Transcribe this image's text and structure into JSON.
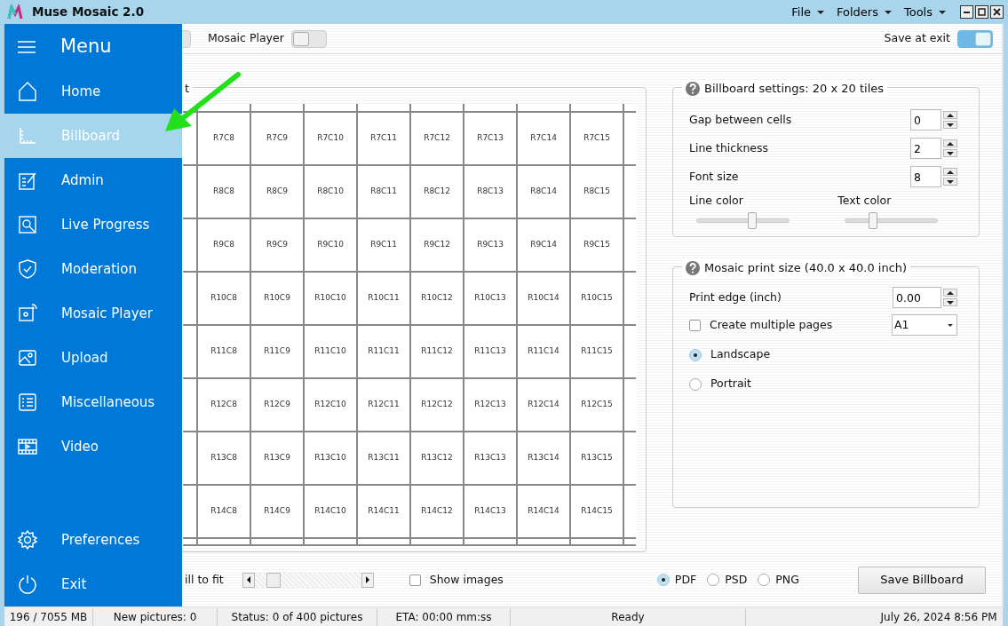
{
  "window": {
    "title": "Muse Mosaic 2.0",
    "menus": [
      "File",
      "Folders",
      "Tools"
    ]
  },
  "toolbar": {
    "toggles": [
      {
        "on": false
      },
      {
        "label": "Mosaic Player",
        "on": false
      },
      {
        "label": "Save at exit",
        "on": true
      }
    ]
  },
  "layout_group": {
    "title": "t",
    "rows": [
      [
        "R7C8",
        "R7C9",
        "R7C10",
        "R7C11",
        "R7C12",
        "R7C13",
        "R7C14",
        "R7C15"
      ],
      [
        "R8C8",
        "R8C9",
        "R8C10",
        "R8C11",
        "R8C12",
        "R8C13",
        "R8C14",
        "R8C15"
      ],
      [
        "R9C8",
        "R9C9",
        "R9C10",
        "R9C11",
        "R9C12",
        "R9C13",
        "R9C14",
        "R9C15"
      ],
      [
        "R10C8",
        "R10C9",
        "R10C10",
        "R10C11",
        "R10C12",
        "R10C13",
        "R10C14",
        "R10C15"
      ],
      [
        "R11C8",
        "R11C9",
        "R11C10",
        "R11C11",
        "R11C12",
        "R11C13",
        "R11C14",
        "R11C15"
      ],
      [
        "R12C8",
        "R12C9",
        "R12C10",
        "R12C11",
        "R12C12",
        "R12C13",
        "R12C14",
        "R12C15"
      ],
      [
        "R13C8",
        "R13C9",
        "R13C10",
        "R13C11",
        "R13C12",
        "R13C13",
        "R13C14",
        "R13C15"
      ],
      [
        "R14C8",
        "R14C9",
        "R14C10",
        "R14C11",
        "R14C12",
        "R14C13",
        "R14C14",
        "R14C15"
      ]
    ]
  },
  "billboard_settings": {
    "title": "Billboard settings: 20 x 20 tiles",
    "spinners": [
      {
        "label": "Gap between cells",
        "value": "0"
      },
      {
        "label": "Line thickness",
        "value": "2"
      },
      {
        "label": "Font size",
        "value": "8"
      }
    ],
    "sliders": [
      {
        "label": "Line color",
        "level": 0.6
      },
      {
        "label": "Text color",
        "level": 0.3
      }
    ]
  },
  "print_size": {
    "title": "Mosaic print size (40.0 x 40.0 inch)",
    "print_edge": {
      "label": "Print edge (inch)",
      "value": "0.00"
    },
    "multiple_pages": {
      "label": "Create multiple pages",
      "checked": false
    },
    "paper": {
      "value": "A1"
    },
    "orientation": [
      {
        "label": "Landscape",
        "selected": true
      },
      {
        "label": "Portrait",
        "selected": false
      }
    ]
  },
  "bottom": {
    "fill_label": "ill to fit",
    "show_images": {
      "label": "Show images",
      "checked": false
    },
    "formats": [
      {
        "label": "PDF",
        "selected": true
      },
      {
        "label": "PSD",
        "selected": false
      },
      {
        "label": "PNG",
        "selected": false
      }
    ],
    "save_button": "Save Billboard"
  },
  "status_bar": [
    "196 / 7055 MB",
    "New pictures: 0",
    "Status: 0 of 400 pictures",
    "ETA: 00:00 mm:ss",
    "Ready",
    "July 26, 2024  8:56 PM"
  ],
  "menu": {
    "title": "Menu",
    "items": [
      {
        "label": "Home",
        "selected": false
      },
      {
        "label": "Billboard",
        "selected": true
      },
      {
        "label": "Admin",
        "selected": false
      },
      {
        "label": "Live Progress",
        "selected": false
      },
      {
        "label": "Moderation",
        "selected": false
      },
      {
        "label": "Mosaic Player",
        "selected": false
      },
      {
        "label": "Upload",
        "selected": false
      },
      {
        "label": "Miscellaneous",
        "selected": false
      },
      {
        "label": "Video",
        "selected": false
      }
    ],
    "footer_items": [
      {
        "label": "Preferences",
        "selected": false
      },
      {
        "label": "Exit",
        "selected": false
      }
    ]
  }
}
